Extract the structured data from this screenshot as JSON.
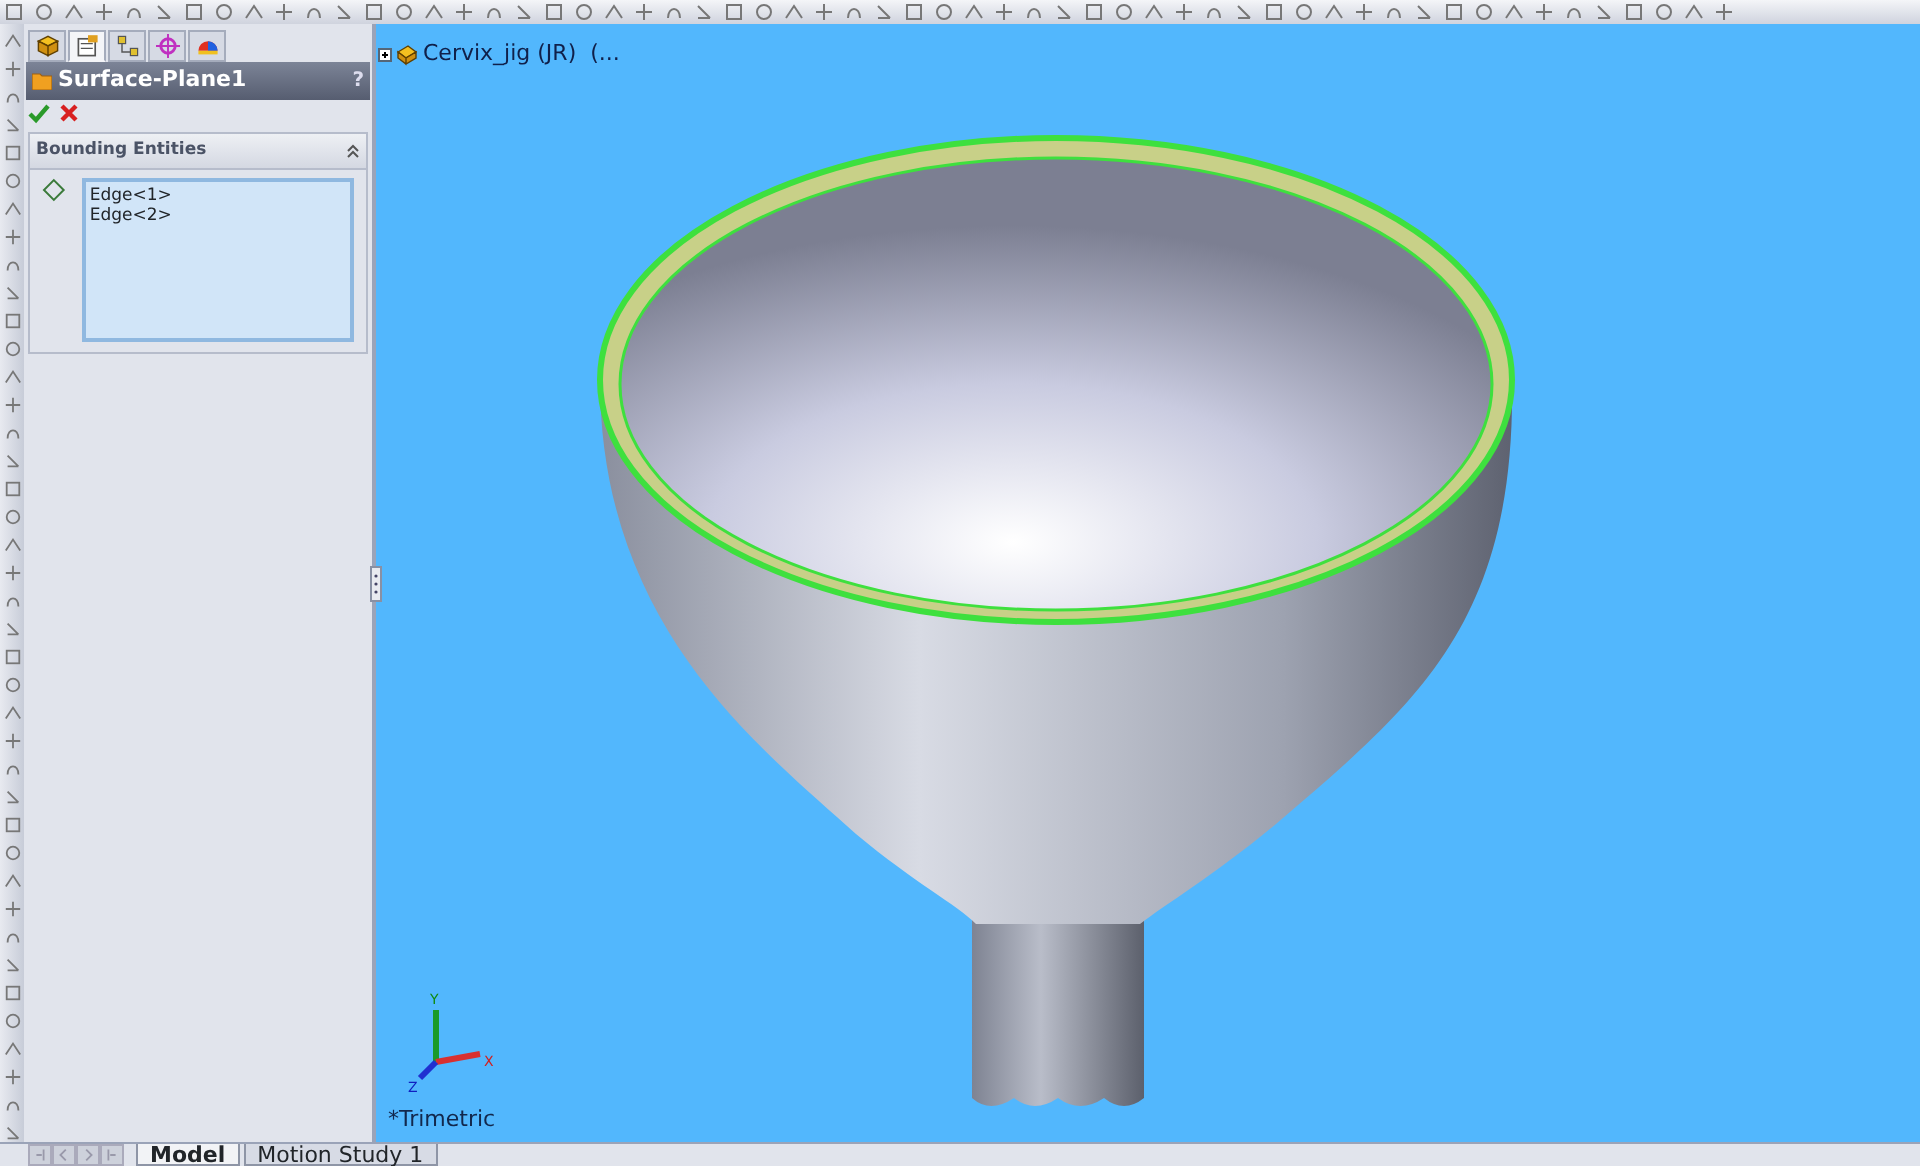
{
  "panel_tabs": [
    {
      "kind": "feature-tree",
      "selected": false
    },
    {
      "kind": "property-manager",
      "selected": true
    },
    {
      "kind": "configuration",
      "selected": false
    },
    {
      "kind": "dimxpert",
      "selected": false
    },
    {
      "kind": "display",
      "selected": false
    }
  ],
  "property_manager": {
    "title": "Surface-Plane1",
    "help": "?",
    "section": {
      "title": "Bounding Entities",
      "expanded": true,
      "items": [
        "Edge<1>",
        "Edge<2>"
      ]
    }
  },
  "viewport": {
    "tree_root": "Cervix_jig (JR)  (...",
    "view_name": "*Trimetric",
    "triad_labels": {
      "y": "Y",
      "x": "X",
      "z": "Z"
    }
  },
  "bottom_tabs": [
    {
      "label": "Model",
      "selected": true
    },
    {
      "label": "Motion Study 1",
      "selected": false
    }
  ]
}
